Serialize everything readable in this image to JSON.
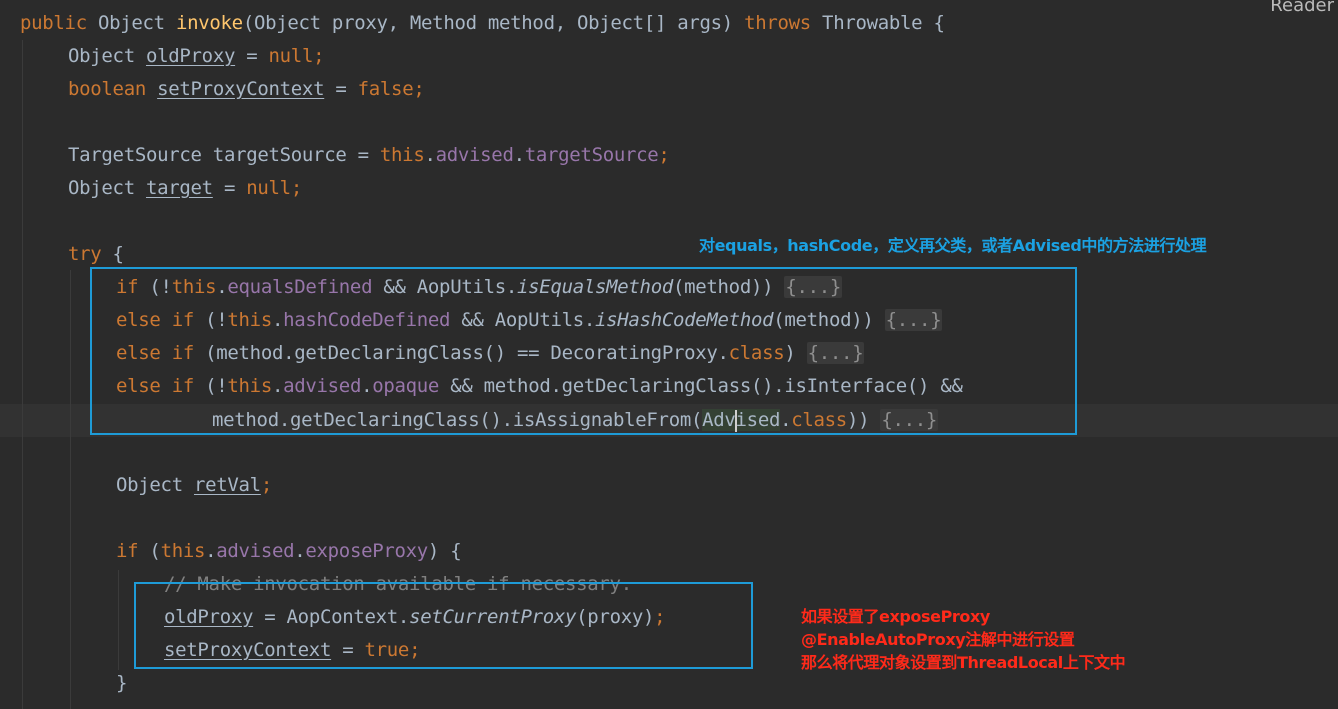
{
  "reader_mode_label": "Reader",
  "code": {
    "l1": {
      "kw_public": "public",
      "t_object": " Object ",
      "fn_invoke": "invoke",
      "t_params": "(Object proxy, Method method, Object[] args) ",
      "kw_throws": "throws",
      "t_throwable": " Throwable {"
    },
    "l2": {
      "t_type": "Object ",
      "var": "oldProxy",
      "t_eq": " = ",
      "kw_null": "null",
      "semi": ";"
    },
    "l3": {
      "kw_boolean": "boolean",
      "sp": " ",
      "var": "setProxyContext",
      "t_eq": " = ",
      "kw_false": "false",
      "semi": ";"
    },
    "l5": {
      "t_decl": "TargetSource targetSource = ",
      "kw_this": "this",
      "dot1": ".",
      "f_advised": "advised",
      "dot2": ".",
      "f_targetSource": "targetSource",
      "semi": ";"
    },
    "l6": {
      "t_type": "Object ",
      "var": "target",
      "t_eq": " = ",
      "kw_null": "null",
      "semi": ";"
    },
    "l8": {
      "kw_try": "try",
      "t_brace": " {"
    },
    "l9": {
      "kw_if": "if",
      "t_open": " (!",
      "kw_this": "this",
      "dot": ".",
      "f_equalsDefined": "equalsDefined",
      "t_and": " && AopUtils.",
      "m_isEquals": "isEqualsMethod",
      "t_args": "(method)) ",
      "fold": "{...}"
    },
    "l10": {
      "kw_else_if": "else if",
      "t_open": " (!",
      "kw_this": "this",
      "dot": ".",
      "f_hashCodeDefined": "hashCodeDefined",
      "t_and": " && AopUtils.",
      "m_isHashCode": "isHashCodeMethod",
      "t_args": "(method)) ",
      "fold": "{...}"
    },
    "l11": {
      "kw_else_if": "else if",
      "t_expr": " (method.getDeclaringClass() == DecoratingProxy.",
      "kw_class": "class",
      "t_close": ") ",
      "fold": "{...}"
    },
    "l12": {
      "kw_else_if": "else if",
      "t_open": " (!",
      "kw_this": "this",
      "dot1": ".",
      "f_advised": "advised",
      "dot2": ".",
      "f_opaque": "opaque",
      "t_rest": " && method.getDeclaringClass().isInterface() &&"
    },
    "l13": {
      "t_expr": "method.getDeclaringClass().isAssignableFrom(",
      "t_adv_a": "Adv",
      "t_adv_b": "ised",
      "dot": ".",
      "kw_class": "class",
      "t_close": ")) ",
      "fold": "{...}"
    },
    "l15": {
      "t_type": "Object ",
      "var": "retVal",
      "semi": ";"
    },
    "l17": {
      "kw_if": "if",
      "t_open": " (",
      "kw_this": "this",
      "dot1": ".",
      "f_advised": "advised",
      "dot2": ".",
      "f_exposeProxy": "exposeProxy",
      "t_close": ") {"
    },
    "l18": {
      "comment": "// Make invocation available if necessary."
    },
    "l19": {
      "var": "oldProxy",
      "t_mid": " = AopContext.",
      "m_setCurrentProxy": "setCurrentProxy",
      "t_args": "(proxy)",
      "semi": ";"
    },
    "l20": {
      "var": "setProxyContext",
      "t_eq": " = ",
      "kw_true": "true",
      "semi": ";"
    },
    "l21": {
      "t_brace": "}"
    }
  },
  "annotations": {
    "blue_note": "对equals，hashCode，定义再父类，或者Advised中的方法进行处理",
    "red_note_lines": [
      "如果设置了exposeProxy",
      "@EnableAutoProxy注解中进行设置",
      "那么将代理对象设置到ThreadLocal上下文中"
    ]
  },
  "colors": {
    "background": "#2b2b2b",
    "keyword": "#cc7832",
    "method_decl": "#ffc66d",
    "field": "#9876aa",
    "plain": "#a9b7c6",
    "comment": "#808080",
    "box_border": "#1e9bd7",
    "blue_note": "#1ba1e2",
    "red_note": "#ff2a1a"
  }
}
